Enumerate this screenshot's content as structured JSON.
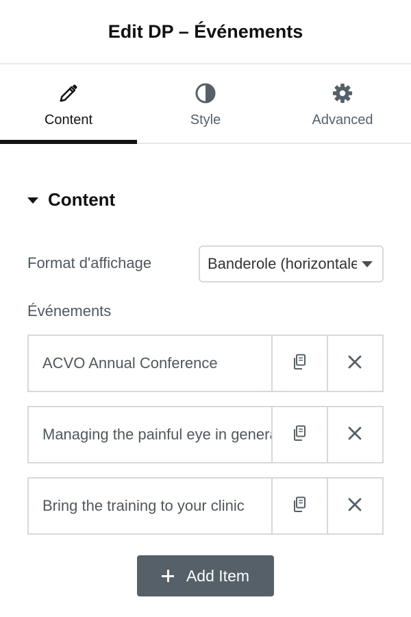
{
  "header": {
    "title": "Edit DP – Événements"
  },
  "tabs": [
    {
      "label": "Content",
      "icon": "pencil-icon",
      "active": true
    },
    {
      "label": "Style",
      "icon": "contrast-icon",
      "active": false
    },
    {
      "label": "Advanced",
      "icon": "gear-icon",
      "active": false
    }
  ],
  "section": {
    "title": "Content"
  },
  "display_format": {
    "label": "Format d'affichage",
    "value": "Banderole (horizontale)"
  },
  "events": {
    "label": "Événements",
    "items": [
      {
        "title": "ACVO Annual Conference"
      },
      {
        "title": "Managing the painful eye in general practice"
      },
      {
        "title": "Bring the training to your clinic"
      }
    ],
    "add_label": "Add Item"
  },
  "colors": {
    "active_tab_underline": "#111111",
    "add_button_bg": "#556068",
    "border": "#d5d8dc"
  }
}
